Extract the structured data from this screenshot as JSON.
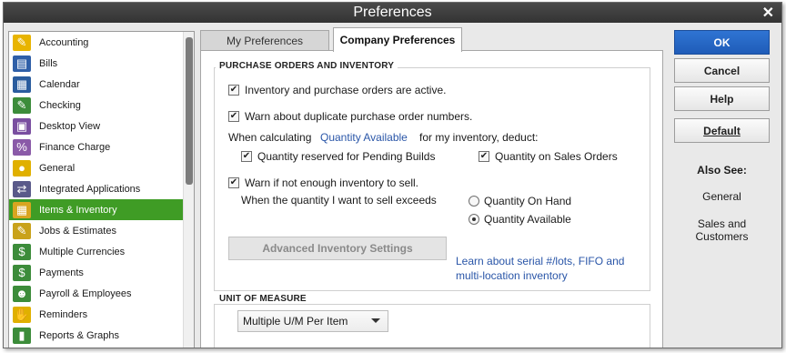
{
  "window": {
    "title": "Preferences",
    "close_glyph": "✕"
  },
  "sidebar": {
    "items": [
      {
        "label": "Accounting",
        "icon": "accounting-icon",
        "glyph": "✎",
        "bg": "#e8b400"
      },
      {
        "label": "Bills",
        "icon": "bills-icon",
        "glyph": "▤",
        "bg": "#2f5fa8"
      },
      {
        "label": "Calendar",
        "icon": "calendar-icon",
        "glyph": "▦",
        "bg": "#2a5c9e"
      },
      {
        "label": "Checking",
        "icon": "checking-icon",
        "glyph": "✎",
        "bg": "#3c8c3a"
      },
      {
        "label": "Desktop View",
        "icon": "desktop-view-icon",
        "glyph": "▣",
        "bg": "#7a4fa0"
      },
      {
        "label": "Finance Charge",
        "icon": "finance-charge-icon",
        "glyph": "%",
        "bg": "#8a5aa8"
      },
      {
        "label": "General",
        "icon": "general-icon",
        "glyph": "●",
        "bg": "#e0b000"
      },
      {
        "label": "Integrated Applications",
        "icon": "integrated-applications-icon",
        "glyph": "⇄",
        "bg": "#5a5a8a"
      },
      {
        "label": "Items & Inventory",
        "icon": "items-inventory-icon",
        "glyph": "▦",
        "bg": "#d9a520",
        "selected": true
      },
      {
        "label": "Jobs & Estimates",
        "icon": "jobs-estimates-icon",
        "glyph": "✎",
        "bg": "#c9a21a"
      },
      {
        "label": "Multiple Currencies",
        "icon": "multiple-currencies-icon",
        "glyph": "$",
        "bg": "#3c8c3a"
      },
      {
        "label": "Payments",
        "icon": "payments-icon",
        "glyph": "$",
        "bg": "#3c8c3a"
      },
      {
        "label": "Payroll & Employees",
        "icon": "payroll-employees-icon",
        "glyph": "☻",
        "bg": "#3c8c3a"
      },
      {
        "label": "Reminders",
        "icon": "reminders-icon",
        "glyph": "✋",
        "bg": "#e0b000"
      },
      {
        "label": "Reports & Graphs",
        "icon": "reports-graphs-icon",
        "glyph": "▮",
        "bg": "#3c8c3a"
      }
    ]
  },
  "tabs": {
    "my_preferences": "My Preferences",
    "company_preferences": "Company Preferences"
  },
  "purchase": {
    "section_title": "PURCHASE ORDERS AND INVENTORY",
    "inventory_active": {
      "label": "Inventory and purchase orders are active.",
      "checked": "✔"
    },
    "warn_duplicate": {
      "label": "Warn about duplicate purchase order numbers.",
      "checked": "✔"
    },
    "calc_prefix": "When calculating",
    "calc_link": "Quantity Available",
    "calc_suffix": "for my inventory, deduct:",
    "qty_pending": {
      "label": "Quantity reserved for Pending Builds",
      "checked": "✔"
    },
    "qty_sales_orders": {
      "label": "Quantity on Sales Orders",
      "checked": "✔"
    },
    "warn_not_enough": {
      "label": "Warn if not enough inventory to sell.",
      "checked": "✔"
    },
    "exceeds_text": "When the quantity I want to sell exceeds",
    "radio_on_hand": {
      "label": "Quantity On Hand",
      "selected": false
    },
    "radio_available": {
      "label": "Quantity Available",
      "selected": true
    },
    "advanced_button": "Advanced Inventory Settings",
    "learn_link_line1": "Learn about serial #/lots, FIFO and",
    "learn_link_line2": "multi-location inventory"
  },
  "uom": {
    "section_title": "UNIT OF MEASURE",
    "selected": "Multiple U/M Per Item"
  },
  "buttons": {
    "ok": "OK",
    "cancel": "Cancel",
    "help": "Help",
    "default": "Default"
  },
  "also_see": {
    "title": "Also See:",
    "general": "General",
    "sales_line1": "Sales and",
    "sales_line2": "Customers"
  },
  "colors": {
    "selected_item": "#3f9c25",
    "primary_button": "#2a6cc9",
    "link": "#2a56a8"
  }
}
